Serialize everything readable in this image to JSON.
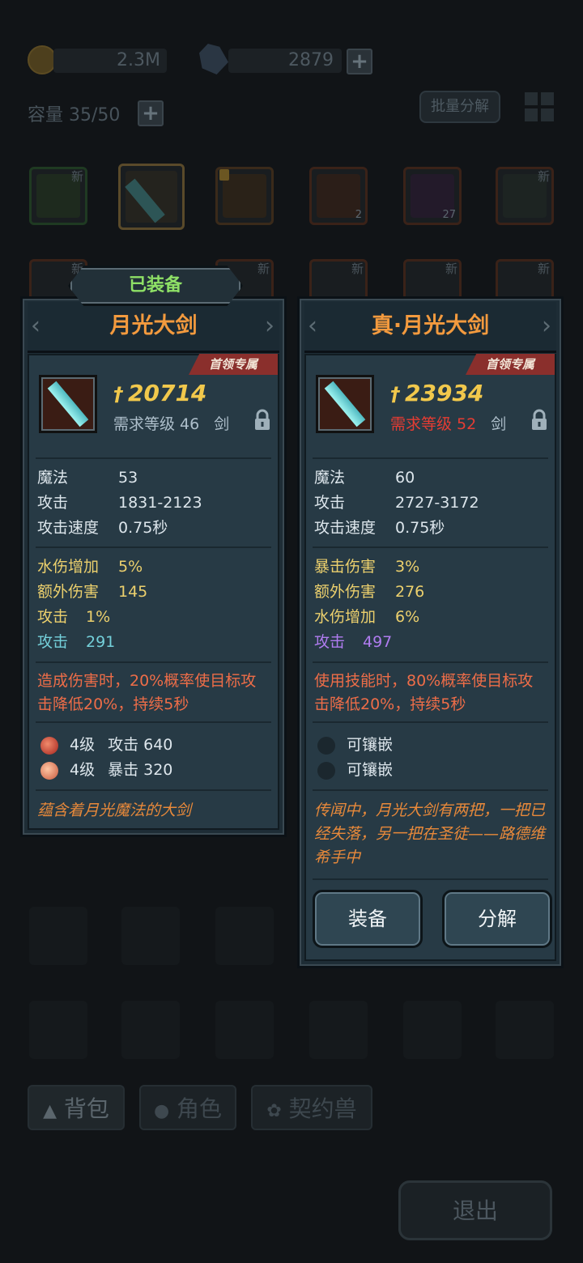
{
  "resources": {
    "gold": "2.3M",
    "crystal": "2879"
  },
  "inventory": {
    "capacity": "容量 35/50",
    "batch_button": "批量分解",
    "items": [
      {
        "badge": "新",
        "count": ""
      },
      {
        "badge": "",
        "count": ""
      },
      {
        "badge": "",
        "count": ""
      },
      {
        "badge": "",
        "count": "2"
      },
      {
        "badge": "",
        "count": "27"
      },
      {
        "badge": "新",
        "count": ""
      }
    ],
    "row2_badges": [
      "新",
      "新",
      "新",
      "新",
      "新"
    ]
  },
  "equipped_banner": "已装备",
  "card_left": {
    "title": "月光大剑",
    "ribbon": "首领专属",
    "power": "20714",
    "req_level": "需求等级 46",
    "weapon_type": "剑",
    "base_stats": [
      {
        "k": "魔法",
        "v": "53"
      },
      {
        "k": "攻击",
        "v": "1831-2123"
      },
      {
        "k": "攻击速度",
        "v": "0.75秒"
      }
    ],
    "bonus_stats": [
      {
        "k": "水伤增加",
        "v": "5%"
      },
      {
        "k": "额外伤害",
        "v": "145"
      },
      {
        "k": "攻击",
        "v": "1%"
      },
      {
        "k": "攻击",
        "v": "291"
      }
    ],
    "effect": "造成伤害时，20%概率使目标攻击降低20%，持续5秒",
    "gems": [
      {
        "lv": "4级",
        "stat": "攻击 640",
        "color": "#c9483b"
      },
      {
        "lv": "4级",
        "stat": "暴击 320",
        "color": "#e58a62"
      }
    ],
    "flavor": "蕴含着月光魔法的大剑"
  },
  "card_right": {
    "title": "真·月光大剑",
    "ribbon": "首领专属",
    "power": "23934",
    "req_level": "需求等级 52",
    "weapon_type": "剑",
    "base_stats": [
      {
        "k": "魔法",
        "v": "60"
      },
      {
        "k": "攻击",
        "v": "2727-3172"
      },
      {
        "k": "攻击速度",
        "v": "0.75秒"
      }
    ],
    "bonus_stats": [
      {
        "k": "暴击伤害",
        "v": "3%"
      },
      {
        "k": "额外伤害",
        "v": "276"
      },
      {
        "k": "水伤增加",
        "v": "6%"
      },
      {
        "k": "攻击",
        "v": "497"
      }
    ],
    "effect": "使用技能时，80%概率使目标攻击降低20%，持续5秒",
    "sockets": [
      "可镶嵌",
      "可镶嵌"
    ],
    "flavor": "传闻中，月光大剑有两把，一把已经失落，另一把在圣徒——路德维希手中",
    "equip_button": "装备",
    "decompose_button": "分解"
  },
  "tabs": [
    "背包",
    "角色",
    "契约兽"
  ],
  "exit_button": "退出",
  "colors": {
    "title_orange": "#f39a3e",
    "power_gold": "#f1c84c",
    "stat_yellow": "#ecd06d",
    "stat_cyan": "#74d0da",
    "stat_purple": "#b07cf0",
    "effect_red": "#ee6d48",
    "req_red": "#e53c33",
    "equipped_green": "#8ee066",
    "ribbon_red": "#8a2f2c"
  }
}
